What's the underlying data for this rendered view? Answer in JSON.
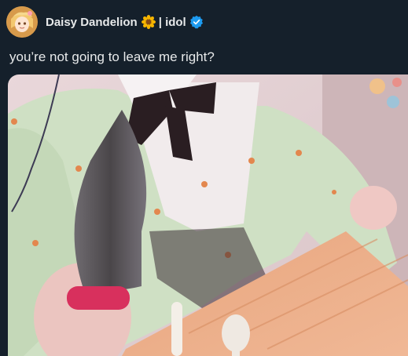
{
  "user": {
    "display_name": "Daisy Dandelion",
    "name_suffix": "| idol",
    "avatar_icon": "avatar-icon",
    "flower_icon": "sunflower-icon",
    "verified_icon": "verified-badge-icon",
    "verified_color": "#1d9bf0"
  },
  "tweet": {
    "text": "you’re not going to leave me right?"
  },
  "media": {
    "type": "video-still"
  }
}
